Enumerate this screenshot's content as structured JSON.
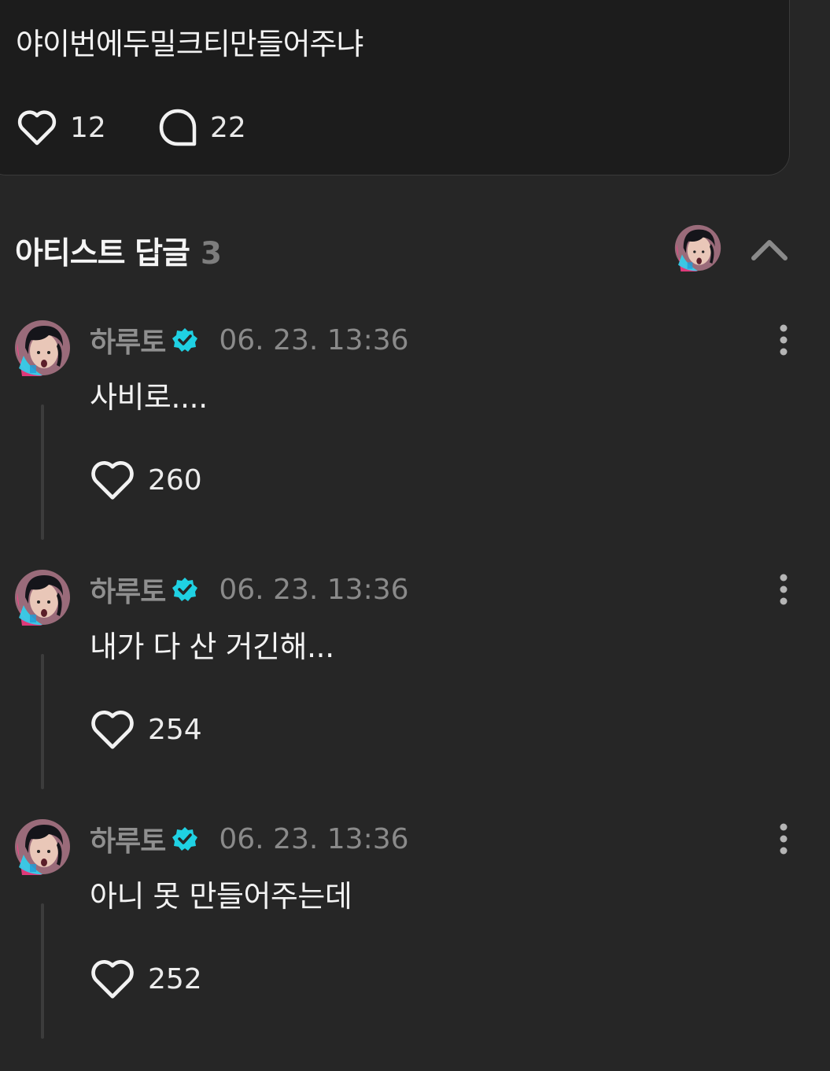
{
  "post": {
    "text": "야이번에두밀크티만들어주냐",
    "like_count": "12",
    "comment_count": "22"
  },
  "artist_replies": {
    "title": "아티스트 답글",
    "count": "3"
  },
  "replies": [
    {
      "author": "하루토",
      "timestamp": "06. 23. 13:36",
      "text": "사비로....",
      "like_count": "260"
    },
    {
      "author": "하루토",
      "timestamp": "06. 23. 13:36",
      "text": "내가 다 산 거긴해...",
      "like_count": "254"
    },
    {
      "author": "하루토",
      "timestamp": "06. 23. 13:36",
      "text": "아니 못 만들어주는데",
      "like_count": "252"
    }
  ],
  "colors": {
    "background": "#262626",
    "card": "#1c1c1c",
    "verified": "#1fd1e3",
    "muted_text": "#8a8a8a"
  },
  "icons": {
    "like": "heart-outline-icon",
    "comment": "speech-bubble-icon",
    "verified": "verified-badge-icon",
    "collapse": "chevron-up-icon",
    "more": "more-vertical-icon"
  }
}
